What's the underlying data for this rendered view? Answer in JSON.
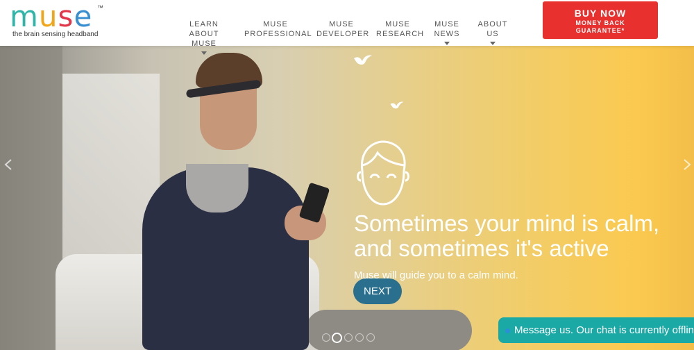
{
  "header": {
    "logo": {
      "wordmark": [
        "m",
        "u",
        "s",
        "e"
      ],
      "trademark": "™",
      "tagline": "the brain sensing headband"
    },
    "nav": [
      {
        "label": "LEARN ABOUT\nMUSE",
        "has_dropdown": true
      },
      {
        "label": "MUSE\nPROFESSIONAL",
        "has_dropdown": false
      },
      {
        "label": "MUSE\nDEVELOPER",
        "has_dropdown": false
      },
      {
        "label": "MUSE\nRESEARCH",
        "has_dropdown": false
      },
      {
        "label": "MUSE\nNEWS",
        "has_dropdown": true
      },
      {
        "label": "ABOUT\nUS",
        "has_dropdown": true
      }
    ],
    "buy": {
      "title": "BUY NOW",
      "subtitle_line1": "MONEY BACK",
      "subtitle_line2": "GUARANTEE*"
    }
  },
  "hero": {
    "headline": "Sometimes your mind is calm,\nand sometimes it's active",
    "subtext": "Muse will guide you to a calm mind.",
    "next_label": "NEXT",
    "slides_total": 5,
    "active_slide": 2
  },
  "chat": {
    "label": "Message us. Our chat is currently offline."
  },
  "colors": {
    "buy_button": "#e8302f",
    "next_button": "#2b6f8f",
    "chat_bar": "#1aa9a5",
    "logo": [
      "#2fb5a8",
      "#f2a516",
      "#e2364a",
      "#3a8fd1"
    ]
  },
  "icons": [
    "bird-icon",
    "face-icon",
    "chevron-left-icon",
    "chevron-right-icon",
    "caret-down-icon"
  ]
}
